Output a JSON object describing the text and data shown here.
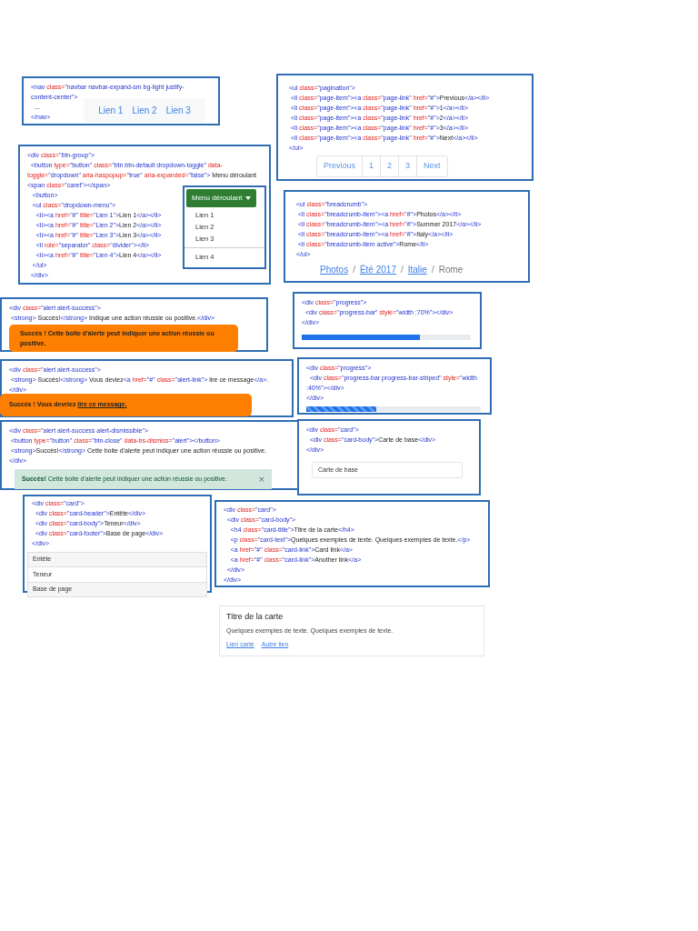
{
  "navbar_example": {
    "code": [
      "<nav class=\"navbar navbar-expand-sm bg-light justify-content-center\">",
      "  ...",
      "</nav>"
    ],
    "links": [
      "Lien 1",
      "Lien 2",
      "Lien 3"
    ]
  },
  "pagination_example": {
    "code": [
      "<ul class=\"pagination\">",
      " <li class=\"page-item\"><a class=\"page-link\" href=\"#\">Previous</a></li>",
      " <li class=\"page-item\"><a class=\"page-link\" href=\"#\">1</a></li>",
      " <li class=\"page-item\"><a class=\"page-link\" href=\"#\">2</a></li>",
      " <li class=\"page-item\"><a class=\"page-link\" href=\"#\">3</a></li>",
      " <li class=\"page-item\"><a class=\"page-link\" href=\"#\">Next</a></li>",
      "</ul>"
    ],
    "pages": [
      "Previous",
      "1",
      "2",
      "3",
      "Next"
    ]
  },
  "dropdown_example": {
    "code": [
      "<div class=\"btn-group\">",
      "  <button type=\"button\" class=\"btn btn-default dropdown-toggle\" data-toggle=\"dropdown\" aria-haspopup=\"true\" aria-expanded=\"false\"> Menu déroulant <span class=\"caret\"></span>",
      "   <button>",
      "   <ul class=\"dropdown-menu\">",
      "     <li><a href=\"#\" title=\"Lien 1\">Lien 1</a></li>",
      "     <li><a href=\"#\" title=\"Lien 2\">Lien 2</a></li>",
      "     <li><a href=\"#\" title=\"Lien 3\">Lien 3</a></li>",
      "     <li role=\"separator\" class=\"divider\"></li>",
      "     <li><a href=\"#\" title=\"Lien 4\">Lien 4</a></li>",
      "   </ul>",
      "  </div>"
    ],
    "button": "Menu déroulant",
    "items": [
      {
        "kind": "item",
        "label": "Lien 1"
      },
      {
        "kind": "item",
        "label": "Lien 2"
      },
      {
        "kind": "item",
        "label": "Lien 3"
      },
      {
        "kind": "divider"
      },
      {
        "kind": "item",
        "label": "Lien 4"
      }
    ]
  },
  "breadcrumb_example": {
    "code": [
      "<ul class=\"breadcrumb\">",
      " <li class=\"breadcrumb-item\"><a href=\"#\">Photos</a></li>",
      " <li class=\"breadcrumb-item\"><a href=\"#\">Summer 2017</a></li>",
      " <li class=\"breadcrumb-item\"><a href=\"#\">Italy</a></li>",
      " <li class=\"breadcrumb-item active\">Rome</li>",
      "</ul>"
    ],
    "items": [
      {
        "label": "Photos",
        "active": false
      },
      {
        "label": "Été 2017",
        "active": false
      },
      {
        "label": "Italie",
        "active": false
      },
      {
        "label": "Rome",
        "active": true
      }
    ],
    "separator": "/"
  },
  "alert_example": {
    "code": [
      "<div class=\"alert alert-success\">",
      " <strong> Succès!</strong> Indique une action réussie ou positive.</div>"
    ],
    "message": "Succès ! Cette boite d'alerte peut indiquer une action réussie ou positive."
  },
  "progress_example": {
    "code": [
      "<div class=\"progress\">",
      "  <div class=\"progress-bar\" style=\"width :70%\"></div>",
      "</div>"
    ],
    "level": 0.7,
    "striped": false
  },
  "alert_link_example": {
    "code": [
      "<div class=\"alert alert-success\">",
      " <strong> Succès!</strong> Vous deviez<a href=\"#\" class=\"alert-link\"> lire ce message</a>.",
      "</div>"
    ],
    "message": "Succès ! Vous devriez ",
    "link": "lire ce message."
  },
  "striped_progress_example": {
    "code": [
      "<div class=\"progress\">",
      "  <div class=\"progress-bar progress-bar-striped\" style=\"width :40%\"></div>",
      "</div>"
    ],
    "level": 0.4,
    "striped": true
  },
  "dismissible_alert_example": {
    "code": [
      "<div class=\"alert alert-success alert-dismissible\">",
      " <button type=\"button\" class=\"btn-close\" data-bs-dismiss=\"alert\"></button>",
      " <strong>Succès!</strong> Cette boite d'alerte peut indiquer une action réussie ou positive.",
      "</div>"
    ],
    "message": "**Succès!** Cette boite d'alerte peut indiquer une action réussie ou positive.",
    "close": "×"
  },
  "basic_card_example": {
    "code": [
      "<div class=\"card\">",
      "  <div class=\"card-body\">Carte de base</div>",
      "</div>"
    ],
    "body": "Carte de base"
  },
  "card_sections_example": {
    "code": [
      "<div class=\"card\">",
      "  <div class=\"card-header\">Entête</div>",
      "  <div class=\"card-body\">Teneur</div>",
      "  <div class=\"card-footer\">Base de page</div>",
      "</div>"
    ],
    "header": "Entête",
    "body": "Teneur",
    "footer": "Base de page"
  },
  "card_title_example": {
    "code": [
      "<div class=\"card\">",
      "  <div class=\"card-body\">",
      "    <h4 class=\"card-title\">Titre de la carte</h4>",
      "    <p class=\"card-text\">Quelques exemples de texte. Quelques exemples de texte.</p>",
      "    <a href=\"#\" class=\"card-link\">Card link</a>",
      "    <a href=\"#\" class=\"card-link\">Another link</a>",
      "  </div>",
      "</div>"
    ],
    "title": "Titre de la carte",
    "text": "Quelques exemples de texte. Quelques exemples de texte.",
    "links": [
      "Lien carte",
      "Autre lien"
    ]
  }
}
